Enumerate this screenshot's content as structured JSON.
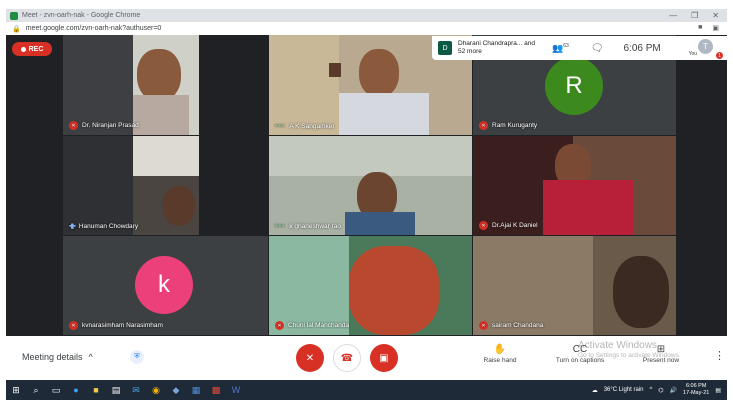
{
  "browser": {
    "title": "Meet - zvn-oarh-nak - Google Chrome",
    "url": "meet.google.com/zvn-oarh-nak?authuser=0",
    "minimize": "—",
    "restore": "❐",
    "close": "✕"
  },
  "meeting": {
    "rec_label": "REC",
    "presenter_initial": "D",
    "presenter_text": "Dharani Chandrapra... and 52 more",
    "people_count": "63",
    "time": "6:06 PM",
    "you_initial": "T",
    "you_label": "You",
    "notification_count": "1"
  },
  "participants": [
    {
      "name": "Dr. Niranjan Prasad",
      "status": "muted"
    },
    {
      "name": "A K Sangamker",
      "status": "active"
    },
    {
      "name": "Ram Kuruganty",
      "status": "muted",
      "avatar_letter": "R",
      "avatar_color": "#3c8a1e"
    },
    {
      "name": "Hanuman Chowdary",
      "status": "speaking"
    },
    {
      "name": "k ghaneshwar rao",
      "status": "active"
    },
    {
      "name": "Dr.Ajai K Daniel",
      "status": "muted"
    },
    {
      "name": "kvnarasimham Narasimham",
      "status": "muted",
      "avatar_letter": "k",
      "avatar_color": "#ec407a"
    },
    {
      "name": "Chuni lal Manchanda",
      "status": "muted"
    },
    {
      "name": "sairam Chandana",
      "status": "muted"
    }
  ],
  "toolbar": {
    "meeting_details": "Meeting details",
    "raise_hand": "Raise hand",
    "captions": "Turn on captions",
    "captions_icon": "CC",
    "present": "Present now",
    "activate_title": "Activate Windows",
    "activate_sub": "Go to Settings to activate Windows.",
    "more": "⋮"
  },
  "taskbar": {
    "weather": "36°C  Light rain",
    "time": "6:06 PM",
    "date": "17-May-21"
  },
  "colors": {
    "danger": "#d93025",
    "stage": "#202124",
    "taskbar": "#1f2a38"
  }
}
